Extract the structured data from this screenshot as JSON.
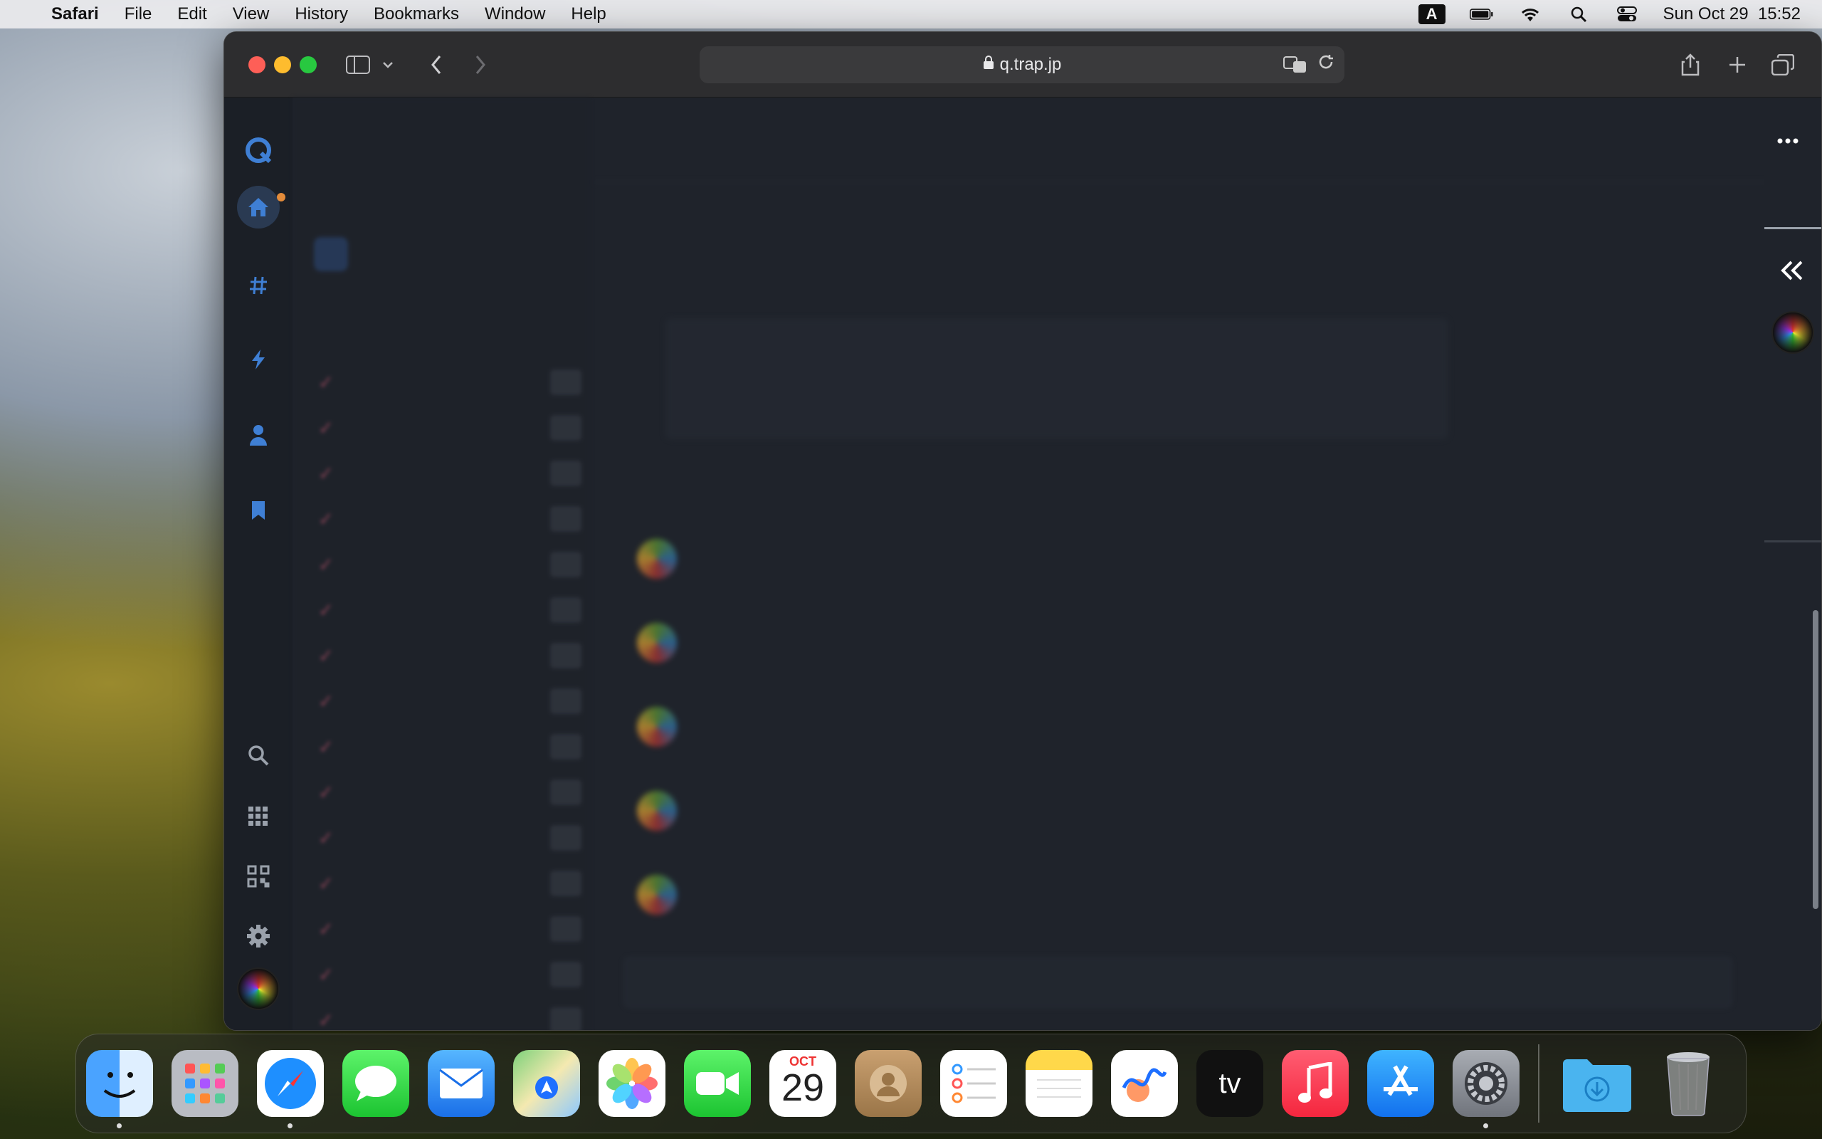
{
  "menubar": {
    "app_name": "Safari",
    "menus": [
      "File",
      "Edit",
      "View",
      "History",
      "Bookmarks",
      "Window",
      "Help"
    ],
    "input_source": "A",
    "datetime": "Sun Oct 29  15:52"
  },
  "browser": {
    "url": "q.trap.jp"
  },
  "dock": {
    "apps": [
      "Finder",
      "Launchpad",
      "Safari",
      "Messages",
      "Mail",
      "Maps",
      "Photos",
      "FaceTime",
      "Calendar",
      "Contacts",
      "Reminders",
      "Notes",
      "Freeform",
      "TV",
      "Music",
      "App Store",
      "System Settings"
    ],
    "calendar_month": "OCT",
    "calendar_day": "29",
    "tv_label": "tv"
  },
  "colors": {
    "accent": "#3f7fd4",
    "notify": "#e38b3a"
  }
}
